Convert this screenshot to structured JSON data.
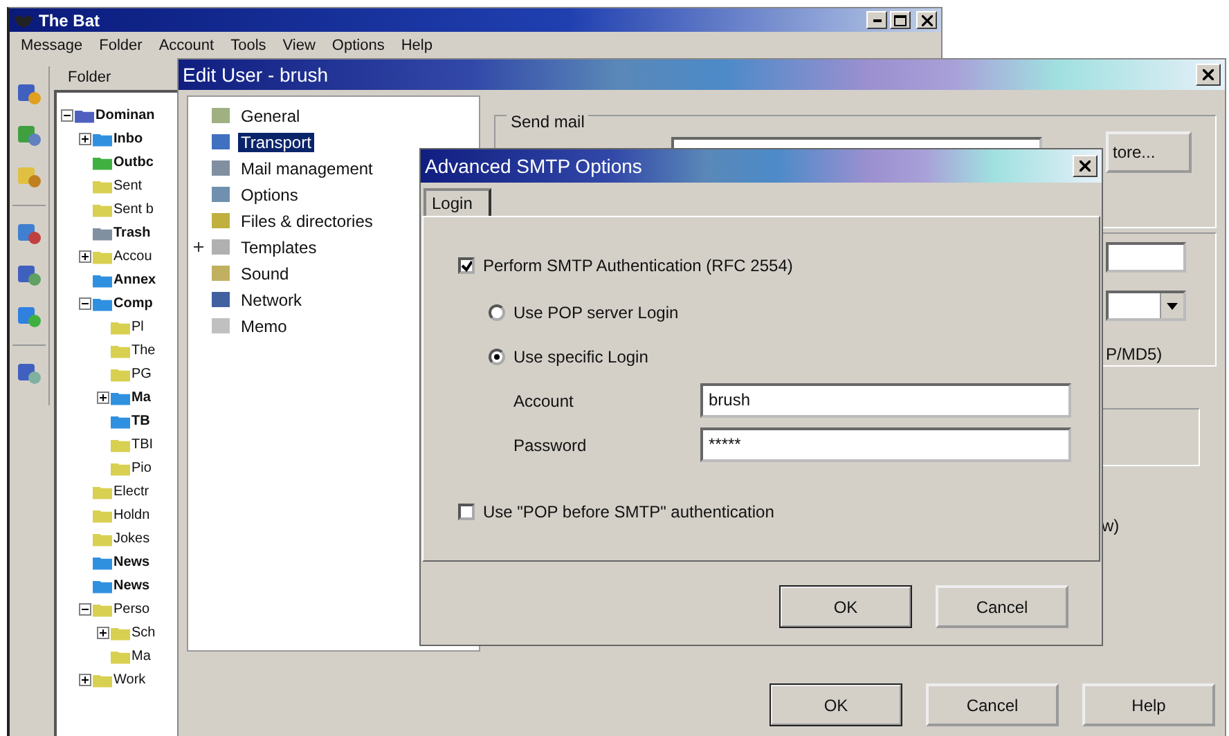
{
  "main_window": {
    "title": "The Bat",
    "menu": [
      "Message",
      "Folder",
      "Account",
      "Tools",
      "View",
      "Options",
      "Help"
    ],
    "folder_header": "Folder",
    "folders": [
      {
        "name": "Dominan",
        "bold": true,
        "expanded": true,
        "color": "#5060c0",
        "children": [
          {
            "name": "Inbo",
            "bold": true,
            "expanded": false,
            "color": "#3090e0"
          },
          {
            "name": "Outbc",
            "bold": true,
            "color": "#40b040"
          },
          {
            "name": "Sent",
            "bold": false,
            "color": "#d8d050"
          },
          {
            "name": "Sent b",
            "bold": false,
            "color": "#d8d050"
          },
          {
            "name": "Trash",
            "bold": true,
            "color": "#8090a0"
          },
          {
            "name": "Accou",
            "bold": false,
            "expanded": false,
            "color": "#d8d050"
          },
          {
            "name": "Annex",
            "bold": true,
            "color": "#3090e0"
          },
          {
            "name": "Comp",
            "bold": true,
            "expanded": true,
            "color": "#3090e0",
            "children": [
              {
                "name": "Pl",
                "bold": false,
                "color": "#d8d050"
              },
              {
                "name": "The",
                "bold": false,
                "color": "#d8d050"
              },
              {
                "name": "PG",
                "bold": false,
                "color": "#d8d050"
              },
              {
                "name": "Ma",
                "bold": true,
                "expanded": false,
                "color": "#3090e0"
              },
              {
                "name": "TB",
                "bold": true,
                "color": "#3090e0"
              },
              {
                "name": "TBI",
                "bold": false,
                "color": "#d8d050"
              },
              {
                "name": "Pio",
                "bold": false,
                "color": "#d8d050"
              }
            ]
          },
          {
            "name": "Electr",
            "bold": false,
            "color": "#d8d050"
          },
          {
            "name": "Holdn",
            "bold": false,
            "color": "#d8d050"
          },
          {
            "name": "Jokes",
            "bold": false,
            "color": "#d8d050"
          },
          {
            "name": "News",
            "bold": true,
            "color": "#3090e0"
          },
          {
            "name": "News",
            "bold": true,
            "color": "#3090e0"
          },
          {
            "name": "Perso",
            "bold": false,
            "expanded": true,
            "color": "#d8d050",
            "children": [
              {
                "name": "Sch",
                "bold": false,
                "expanded": false,
                "color": "#d8d050"
              },
              {
                "name": "Ma",
                "bold": false,
                "color": "#d8d050"
              }
            ]
          },
          {
            "name": "Work",
            "bold": false,
            "expanded": false,
            "color": "#d8d050"
          }
        ]
      }
    ]
  },
  "edit_user": {
    "title": "Edit User - brush",
    "sections": [
      {
        "label": "General",
        "selected": false
      },
      {
        "label": "Transport",
        "selected": true
      },
      {
        "label": "Mail management",
        "selected": false
      },
      {
        "label": "Options",
        "selected": false
      },
      {
        "label": "Files & directories",
        "selected": false
      },
      {
        "label": "Templates",
        "selected": false
      },
      {
        "label": "Sound",
        "selected": false
      },
      {
        "label": "Network",
        "selected": false
      },
      {
        "label": "Memo",
        "selected": false
      }
    ],
    "send_mail_label": "Send mail",
    "more_button": "tore...",
    "auth_note": "P/MD5)",
    "note_2": "w)",
    "buttons": [
      "OK",
      "Cancel",
      "Help"
    ]
  },
  "smtp_dialog": {
    "title": "Advanced SMTP Options",
    "tabs": [
      {
        "label": "Login",
        "selected": true
      }
    ],
    "perform_auth": {
      "label": "Perform SMTP Authentication (RFC 2554)",
      "checked": true
    },
    "login_options": [
      {
        "label": "Use POP server Login",
        "selected": false
      },
      {
        "label": "Use specific Login",
        "selected": true
      }
    ],
    "account": {
      "label": "Account",
      "value": "brush"
    },
    "password": {
      "label": "Password",
      "value": "*****"
    },
    "pop_before_smtp": {
      "label": "Use \"POP before SMTP\" authentication",
      "checked": false
    },
    "buttons": [
      "OK",
      "Cancel"
    ]
  }
}
